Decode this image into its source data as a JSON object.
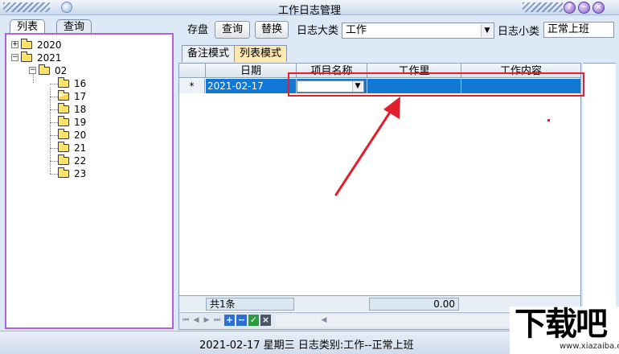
{
  "window": {
    "title": "工作日志管理",
    "buttons": [
      "?",
      "−",
      "×"
    ]
  },
  "left_tabs": [
    {
      "label": "列表",
      "active": true
    },
    {
      "label": "查询",
      "active": false
    }
  ],
  "tree": {
    "y2020": "2020",
    "y2021": "2021",
    "month": "02",
    "days": [
      "16",
      "17",
      "18",
      "19",
      "20",
      "21",
      "22",
      "23"
    ],
    "open_day": "17"
  },
  "toolbar": {
    "save_label": "存盘",
    "query_label": "查询",
    "replace_label": "替换",
    "category_label": "日志大类",
    "category_value": "工作",
    "subcategory_label": "日志小类",
    "subcategory_value": "正常上班"
  },
  "mode_tabs": [
    {
      "label": "备注模式",
      "active": false
    },
    {
      "label": "列表模式",
      "active": true
    }
  ],
  "grid": {
    "columns": [
      "日期",
      "项目名称",
      "工作里",
      "工作内容"
    ],
    "rows": [
      {
        "indicator": "*",
        "date": "2021-02-17",
        "project": "",
        "amount": "",
        "content": ""
      }
    ],
    "footer": {
      "count": "共1条",
      "total": "0.00"
    }
  },
  "status_text": "2021-02-17 星期三 日志类别:工作--正常上班",
  "watermark": {
    "main": "下载吧",
    "sub": "www.xiazaiba.com"
  },
  "colors": {
    "selection": "#1278d6",
    "highlight": "#e0202a",
    "tree_border": "#b262d8"
  }
}
